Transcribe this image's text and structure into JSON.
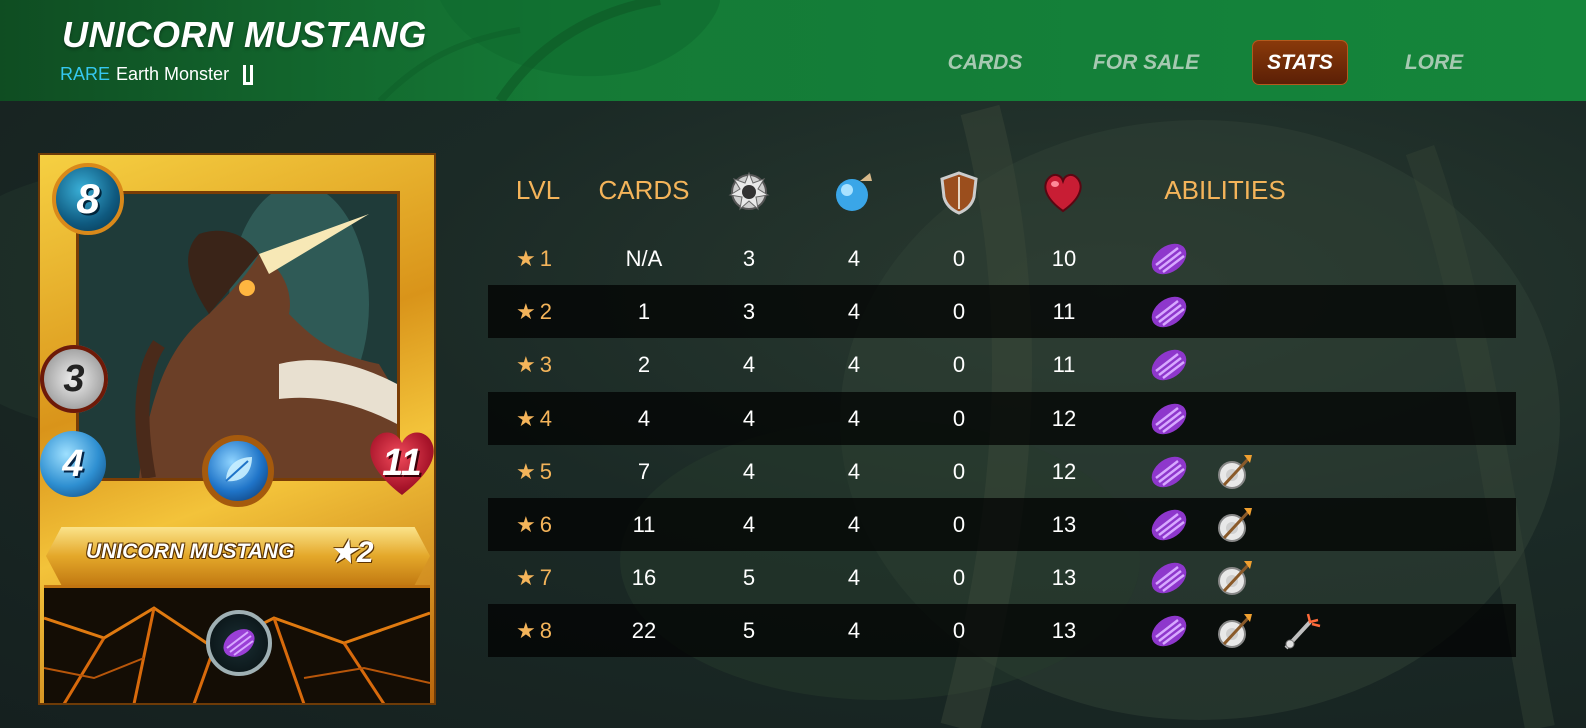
{
  "header": {
    "title": "UNICORN MUSTANG",
    "rarity": "RARE",
    "type": "Earth Monster",
    "edition_icon": "untamed-edition-icon"
  },
  "nav": {
    "items": [
      {
        "label": "CARDS",
        "active": false
      },
      {
        "label": "FOR SALE",
        "active": false
      },
      {
        "label": "STATS",
        "active": true
      },
      {
        "label": "LORE",
        "active": false
      }
    ]
  },
  "card": {
    "name": "UNICORN MUSTANG",
    "level": "★2",
    "mana": "8",
    "attack": "3",
    "speed": "4",
    "health": "11",
    "element_icon": "earth-leaf-gem-icon",
    "ability_icon": "shield-ability-icon"
  },
  "stats": {
    "headers": {
      "lvl": "LVL",
      "cards": "CARDS",
      "attack_icon": "melee-attack-icon",
      "speed_icon": "speed-icon",
      "armor_icon": "armor-shield-icon",
      "health_icon": "heart-icon",
      "abilities": "ABILITIES"
    },
    "rows": [
      {
        "lvl": "1",
        "cards": "N/A",
        "attack": "3",
        "speed": "4",
        "armor": "0",
        "health": "10",
        "abilities": [
          "shield"
        ]
      },
      {
        "lvl": "2",
        "cards": "1",
        "attack": "3",
        "speed": "4",
        "armor": "0",
        "health": "11",
        "abilities": [
          "shield"
        ]
      },
      {
        "lvl": "3",
        "cards": "2",
        "attack": "4",
        "speed": "4",
        "armor": "0",
        "health": "11",
        "abilities": [
          "shield"
        ]
      },
      {
        "lvl": "4",
        "cards": "4",
        "attack": "4",
        "speed": "4",
        "armor": "0",
        "health": "12",
        "abilities": [
          "shield"
        ]
      },
      {
        "lvl": "5",
        "cards": "7",
        "attack": "4",
        "speed": "4",
        "armor": "0",
        "health": "12",
        "abilities": [
          "shield",
          "true-strike"
        ]
      },
      {
        "lvl": "6",
        "cards": "11",
        "attack": "4",
        "speed": "4",
        "armor": "0",
        "health": "13",
        "abilities": [
          "shield",
          "true-strike"
        ]
      },
      {
        "lvl": "7",
        "cards": "16",
        "attack": "5",
        "speed": "4",
        "armor": "0",
        "health": "13",
        "abilities": [
          "shield",
          "true-strike"
        ]
      },
      {
        "lvl": "8",
        "cards": "22",
        "attack": "5",
        "speed": "4",
        "armor": "0",
        "health": "13",
        "abilities": [
          "shield",
          "true-strike",
          "piercing"
        ]
      }
    ]
  },
  "colors": {
    "header_green": "#157a36",
    "accent_orange": "#f4b45a",
    "rarity_blue": "#35c8f0",
    "active_tab": "#6e2a08"
  }
}
